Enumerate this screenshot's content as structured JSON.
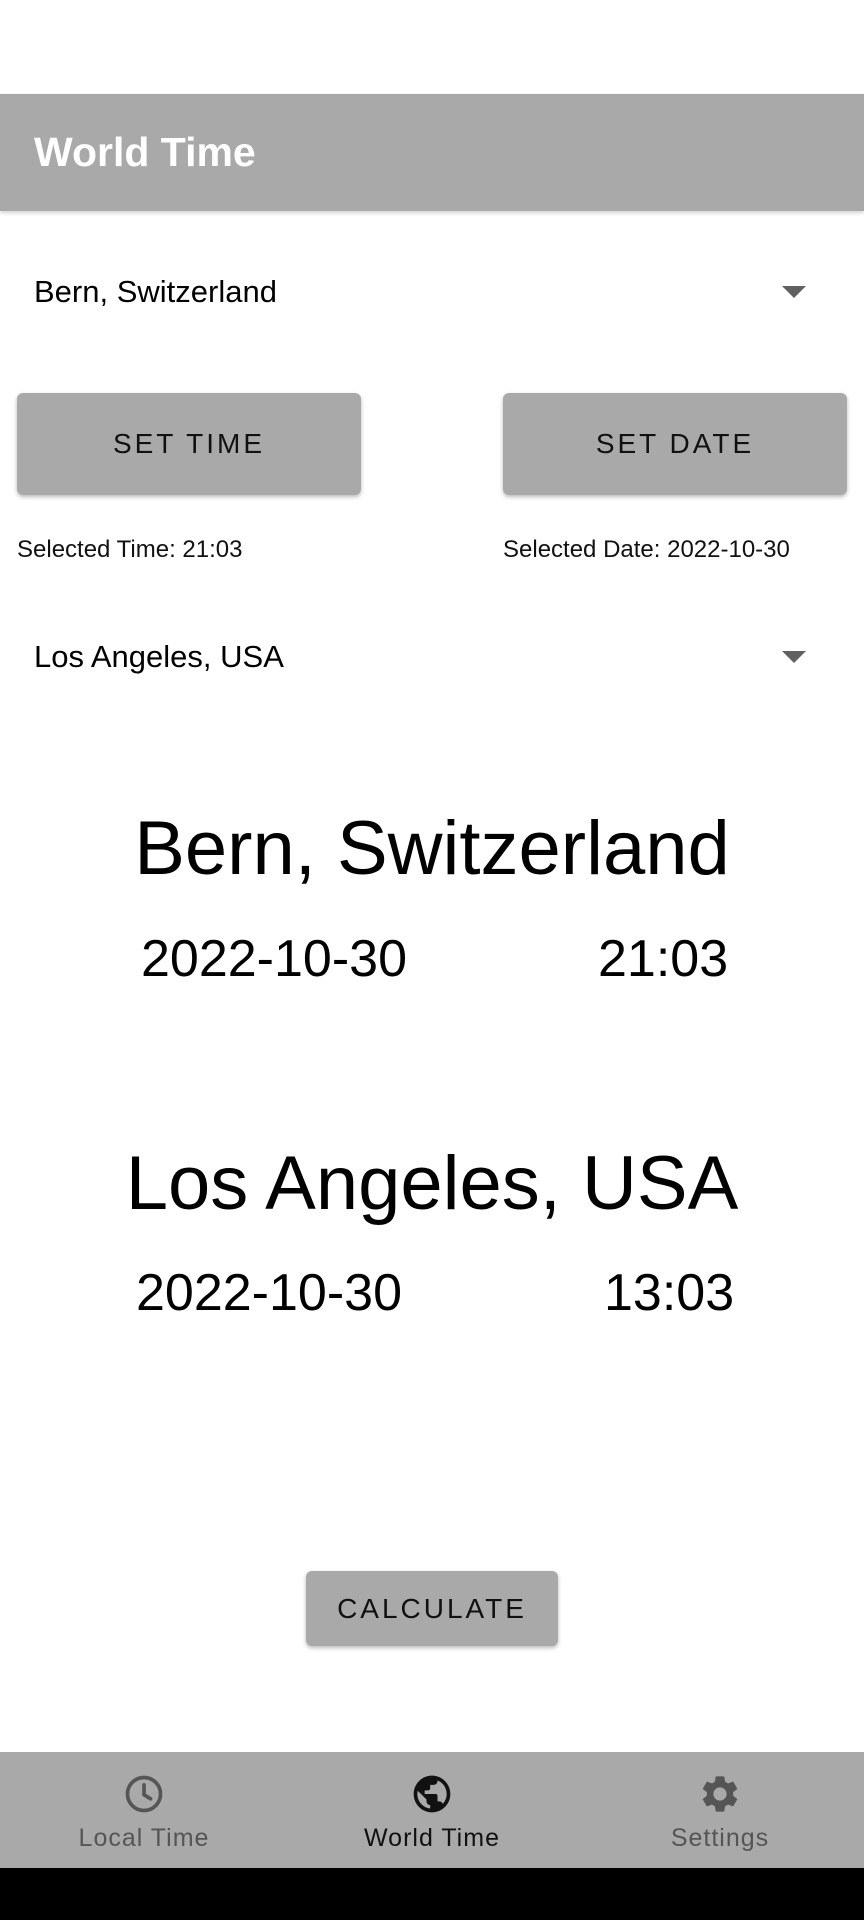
{
  "app_bar": {
    "title": "World Time"
  },
  "source_city_dropdown": {
    "value": "Bern, Switzerland"
  },
  "set_time_button": {
    "label": "SET TIME"
  },
  "set_date_button": {
    "label": "SET DATE"
  },
  "selected_time": {
    "text": "Selected Time: 21:03"
  },
  "selected_date": {
    "text": "Selected Date: 2022-10-30"
  },
  "target_city_dropdown": {
    "value": "Los Angeles, USA"
  },
  "result_source": {
    "city": "Bern, Switzerland",
    "date": "2022-10-30",
    "time": "21:03"
  },
  "result_target": {
    "city": "Los Angeles, USA",
    "date": "2022-10-30",
    "time": "13:03"
  },
  "calculate_button": {
    "label": "CALCULATE"
  },
  "bottom_nav": {
    "items": [
      {
        "label": "Local Time",
        "icon": "clock-icon",
        "active": false
      },
      {
        "label": "World Time",
        "icon": "globe-icon",
        "active": true
      },
      {
        "label": "Settings",
        "icon": "gear-icon",
        "active": false
      }
    ]
  },
  "colors": {
    "app_bar": "#a9a9a9",
    "button": "#a9a9a9",
    "nav_active": "#111111",
    "nav_inactive": "#555555"
  }
}
